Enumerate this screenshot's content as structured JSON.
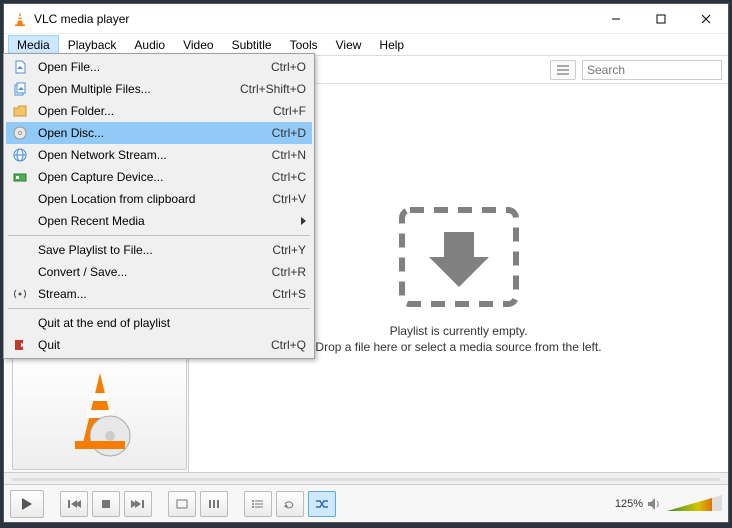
{
  "window": {
    "title": "VLC media player"
  },
  "menubar": [
    "Media",
    "Playback",
    "Audio",
    "Video",
    "Subtitle",
    "Tools",
    "View",
    "Help"
  ],
  "mediaMenu": [
    {
      "icon": "file",
      "label": "Open File...",
      "shortcut": "Ctrl+O"
    },
    {
      "icon": "files",
      "label": "Open Multiple Files...",
      "shortcut": "Ctrl+Shift+O"
    },
    {
      "icon": "folder",
      "label": "Open Folder...",
      "shortcut": "Ctrl+F"
    },
    {
      "icon": "disc",
      "label": "Open Disc...",
      "shortcut": "Ctrl+D",
      "highlight": true
    },
    {
      "icon": "network",
      "label": "Open Network Stream...",
      "shortcut": "Ctrl+N"
    },
    {
      "icon": "capture",
      "label": "Open Capture Device...",
      "shortcut": "Ctrl+C"
    },
    {
      "icon": "",
      "label": "Open Location from clipboard",
      "shortcut": "Ctrl+V"
    },
    {
      "icon": "",
      "label": "Open Recent Media",
      "shortcut": "",
      "submenu": true
    }
  ],
  "mediaMenu2": [
    {
      "icon": "",
      "label": "Save Playlist to File...",
      "shortcut": "Ctrl+Y"
    },
    {
      "icon": "",
      "label": "Convert / Save...",
      "shortcut": "Ctrl+R"
    },
    {
      "icon": "stream",
      "label": "Stream...",
      "shortcut": "Ctrl+S"
    }
  ],
  "mediaMenu3": [
    {
      "icon": "",
      "label": "Quit at the end of playlist",
      "shortcut": ""
    },
    {
      "icon": "quit",
      "label": "Quit",
      "shortcut": "Ctrl+Q"
    }
  ],
  "search": {
    "placeholder": "Search"
  },
  "playlist": {
    "line1": "Playlist is currently empty.",
    "line2": "Drop a file here or select a media source from the left."
  },
  "volume": {
    "label": "125%"
  }
}
